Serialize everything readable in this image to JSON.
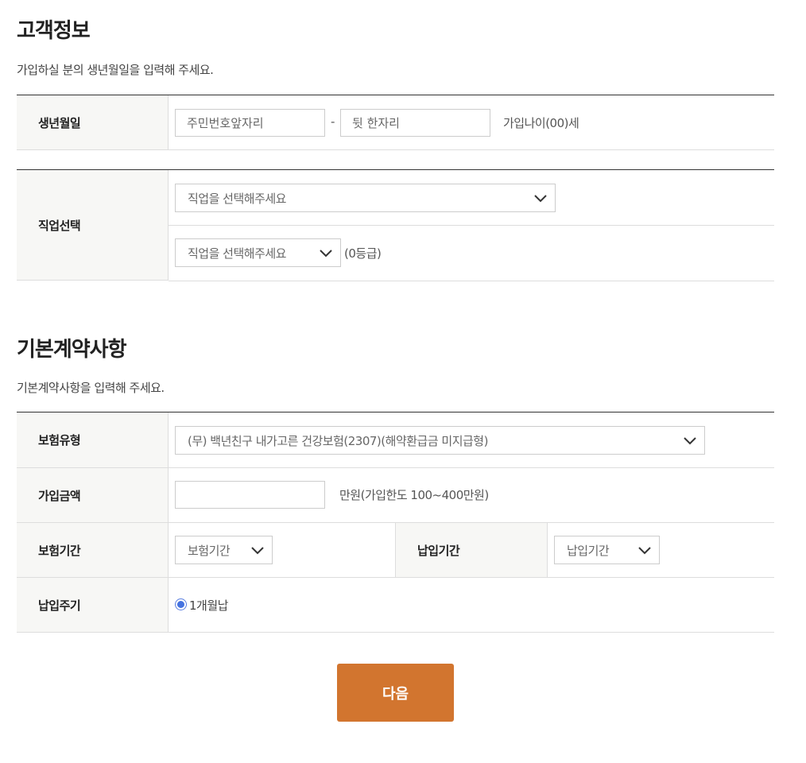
{
  "customer": {
    "title": "고객정보",
    "desc": "가입하실 분의 생년월일을 입력해 주세요.",
    "birth": {
      "label": "생년월일",
      "front_placeholder": "주민번호앞자리",
      "separator": "-",
      "back_placeholder": "뒷 한자리",
      "age_note": "가입나이(00)세"
    },
    "job": {
      "label": "직업선택",
      "select1": "직업을 선택해주세요",
      "select2": "직업을 선택해주세요",
      "grade_note": "(0등급)"
    }
  },
  "contract": {
    "title": "기본계약사항",
    "desc": "기본계약사항을 입력해 주세요.",
    "type": {
      "label": "보험유형",
      "value": "(무) 백년친구 내가고른 건강보험(2307)(해약환급금 미지급형)"
    },
    "amount": {
      "label": "가입금액",
      "value": "",
      "note": "만원(가입한도 100~400만원)"
    },
    "period": {
      "label": "보험기간",
      "select": "보험기간"
    },
    "pay_period": {
      "label": "납입기간",
      "select": "납입기간"
    },
    "cycle": {
      "label": "납입주기",
      "option": "1개월납",
      "checked": true
    }
  },
  "next_button": "다음",
  "icons": {
    "select_arrow": "chevron-down-icon",
    "radio": "radio-checked-icon"
  },
  "colors": {
    "accent": "#d2752f",
    "radio": "#4472e0",
    "header_bg": "#f7f7f5"
  }
}
